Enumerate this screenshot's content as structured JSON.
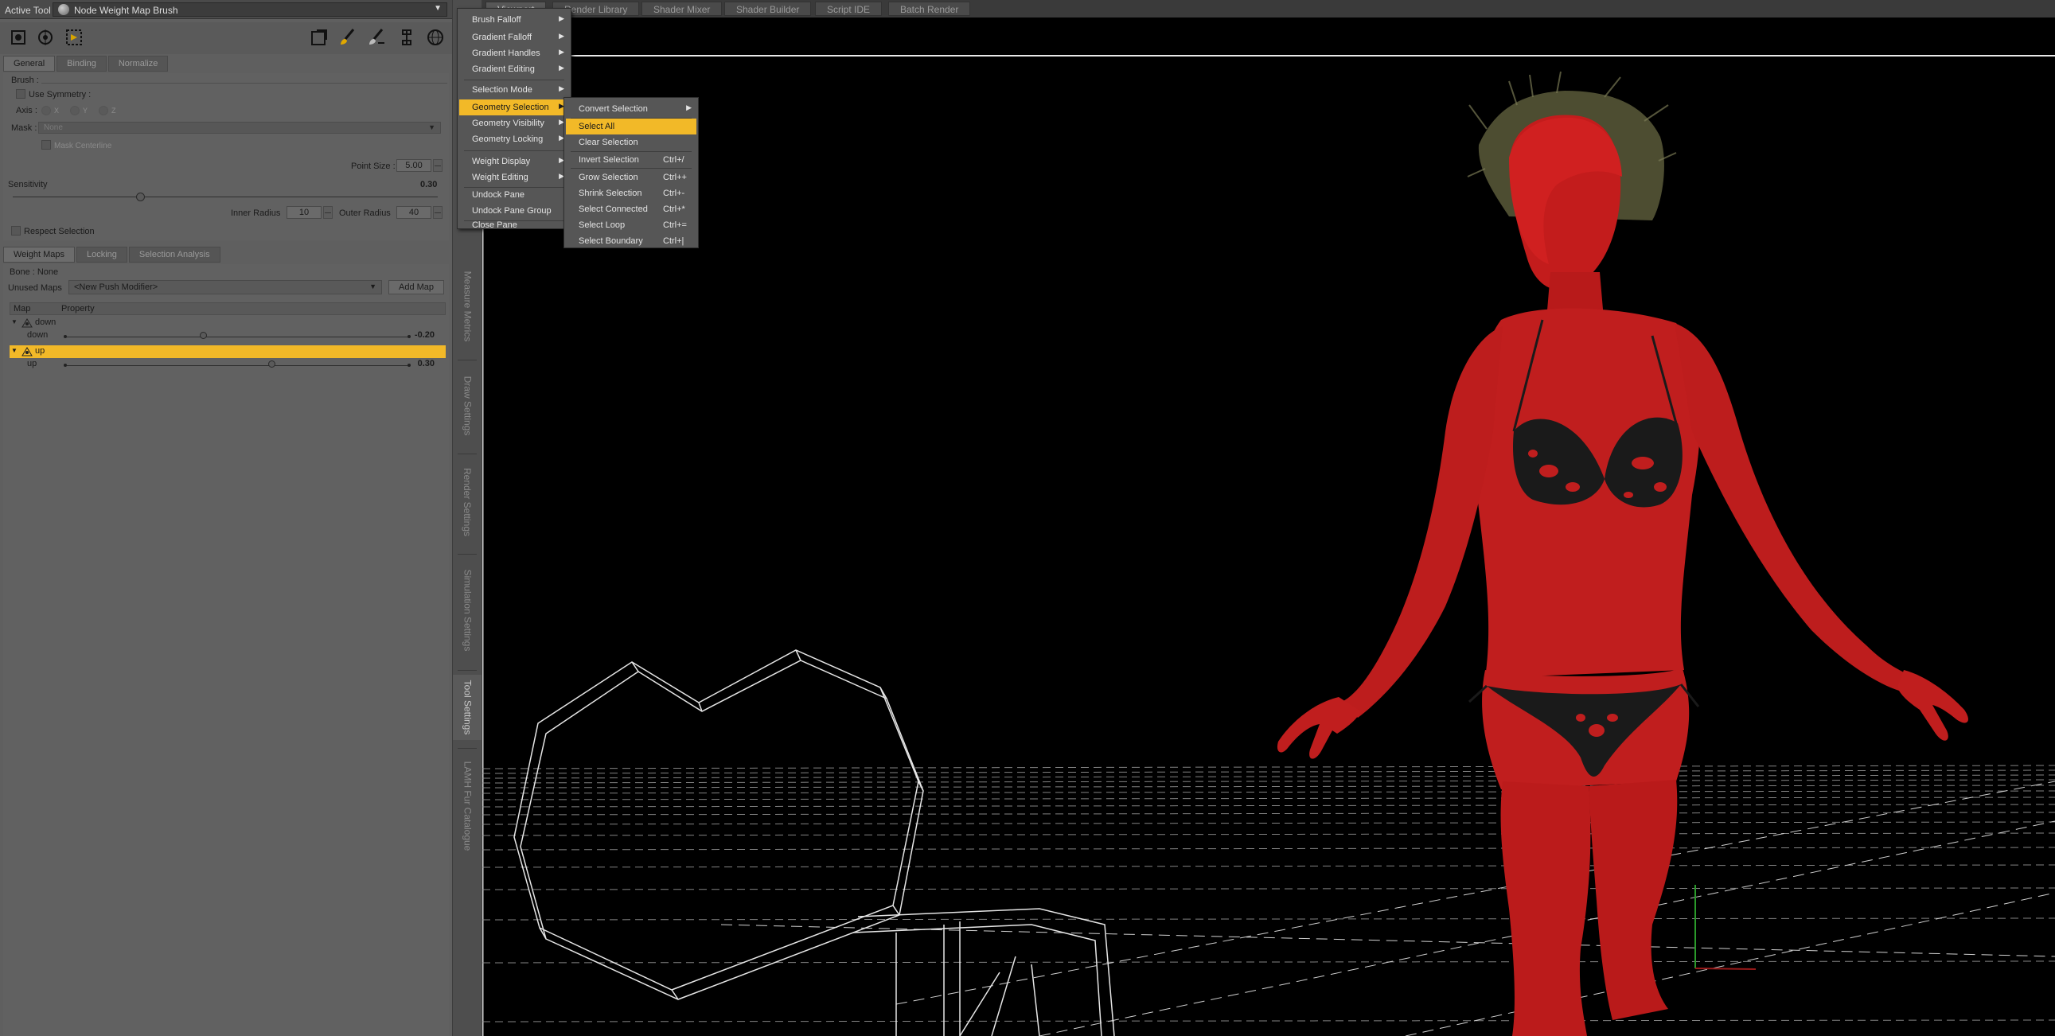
{
  "active_tool": {
    "label": "Active Tool :",
    "value": "Node Weight Map Brush"
  },
  "tool_icons": [
    "select-brush-icon",
    "node-select-icon",
    "region-select-icon",
    "stamp-icon",
    "paint-brush-icon",
    "eraser-brush-icon",
    "pin-icon",
    "globe-target-icon"
  ],
  "general_tabs": [
    "General",
    "Binding",
    "Normalize"
  ],
  "brush": {
    "heading": "Brush :",
    "use_symmetry": "Use Symmetry :",
    "axis_label": "Axis :",
    "axis_options": [
      "X",
      "Y",
      "Z"
    ],
    "mask_label": "Mask :",
    "mask_value": "None",
    "mask_centerline": "Mask Centerline",
    "point_size_label": "Point Size :",
    "point_size_value": "5.00",
    "sensitivity_label": "Sensitivity",
    "sensitivity_value": "0.30",
    "sensitivity_fraction": 0.3,
    "inner_radius_label": "Inner Radius",
    "inner_radius_value": "10",
    "outer_radius_label": "Outer Radius",
    "outer_radius_value": "40",
    "respect_selection": "Respect Selection"
  },
  "weight_tabs": [
    "Weight Maps",
    "Locking",
    "Selection Analysis"
  ],
  "weight_maps": {
    "bone": "Bone : None",
    "unused_label": "Unused Maps",
    "unused_value": "<New Push Modifier>",
    "add_map": "Add Map",
    "col_map": "Map",
    "col_property": "Property",
    "groups": [
      {
        "name": "down",
        "channel": "down",
        "value": "-0.20",
        "fraction": 0.4,
        "selected": false
      },
      {
        "name": "up",
        "channel": "up",
        "value": "0.30",
        "fraction": 0.6,
        "selected": true
      }
    ]
  },
  "vertical_tabs": [
    "Measure Metrics",
    "Draw Settings",
    "Render Settings",
    "Simulation Settings",
    "Tool Settings",
    "LAMH Fur Catalogue"
  ],
  "active_vertical_tab": "Tool Settings",
  "top_tabs": [
    "Viewport",
    "Render Library",
    "Shader Mixer",
    "Shader Builder",
    "Script IDE",
    "Batch Render"
  ],
  "active_top_tab": "Viewport",
  "context_menu": {
    "items": [
      {
        "label": "Brush Falloff",
        "sub": true
      },
      {
        "label": "Gradient Falloff",
        "sub": true
      },
      {
        "label": "Gradient Handles",
        "sub": true
      },
      {
        "label": "Gradient Editing",
        "sub": true
      },
      {
        "label": "Selection Mode",
        "sub": true
      },
      {
        "label": "Geometry Selection",
        "sub": true,
        "highlight": true
      },
      {
        "label": "Geometry Visibility",
        "sub": true
      },
      {
        "label": "Geometry Locking",
        "sub": true
      },
      {
        "label": "Weight Display",
        "sub": true
      },
      {
        "label": "Weight Editing",
        "sub": true
      },
      {
        "label": "Undock Pane",
        "sub": false
      },
      {
        "label": "Undock Pane Group",
        "sub": false
      },
      {
        "label": "Close Pane",
        "sub": false
      }
    ]
  },
  "geometry_selection_menu": {
    "items": [
      {
        "label": "Convert Selection",
        "shortcut": "",
        "sub": true
      },
      {
        "label": "Select All",
        "shortcut": "",
        "highlight": true
      },
      {
        "label": "Clear Selection",
        "shortcut": ""
      },
      {
        "label": "Invert Selection",
        "shortcut": "Ctrl+/"
      },
      {
        "label": "Grow Selection",
        "shortcut": "Ctrl++"
      },
      {
        "label": "Shrink Selection",
        "shortcut": "Ctrl+-"
      },
      {
        "label": "Select Connected",
        "shortcut": "Ctrl+*"
      },
      {
        "label": "Select Loop",
        "shortcut": "Ctrl+="
      },
      {
        "label": "Select Boundary",
        "shortcut": "Ctrl+|"
      }
    ]
  },
  "colors": {
    "highlight": "#f2b928",
    "figure": "#c01e1e",
    "panel": "#5f5f5f"
  }
}
